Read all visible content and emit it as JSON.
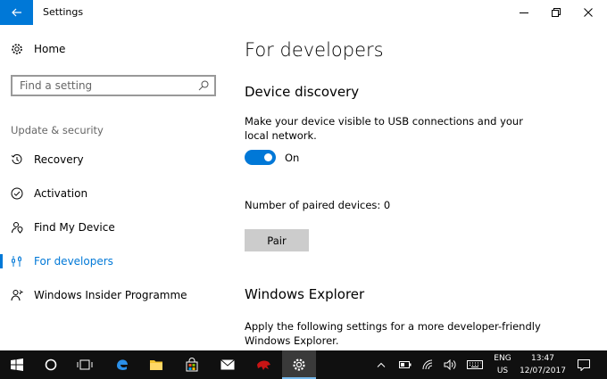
{
  "window": {
    "title": "Settings"
  },
  "sidebar": {
    "home_label": "Home",
    "search_placeholder": "Find a setting",
    "section_heading": "Update & security",
    "items": [
      {
        "label": "Recovery",
        "icon": "history-icon"
      },
      {
        "label": "Activation",
        "icon": "check-circle-icon"
      },
      {
        "label": "Find My Device",
        "icon": "person-pin-icon"
      },
      {
        "label": "For developers",
        "icon": "developer-tools-icon",
        "active": true
      },
      {
        "label": "Windows Insider Programme",
        "icon": "insider-person-icon"
      }
    ]
  },
  "main": {
    "title": "For developers",
    "device_discovery": {
      "heading": "Device discovery",
      "description": "Make your device visible to USB connections and your local network.",
      "toggle_state": "On",
      "toggle_on": true,
      "paired_devices_text": "Number of paired devices: 0",
      "pair_button": "Pair"
    },
    "windows_explorer": {
      "heading": "Windows Explorer",
      "description": "Apply the following settings for a more developer-friendly Windows Explorer."
    }
  },
  "taskbar": {
    "language": "ENG",
    "region": "US",
    "time": "13:47",
    "date": "12/07/2017"
  },
  "colors": {
    "accent": "#0078d7",
    "taskbar": "#101010"
  }
}
